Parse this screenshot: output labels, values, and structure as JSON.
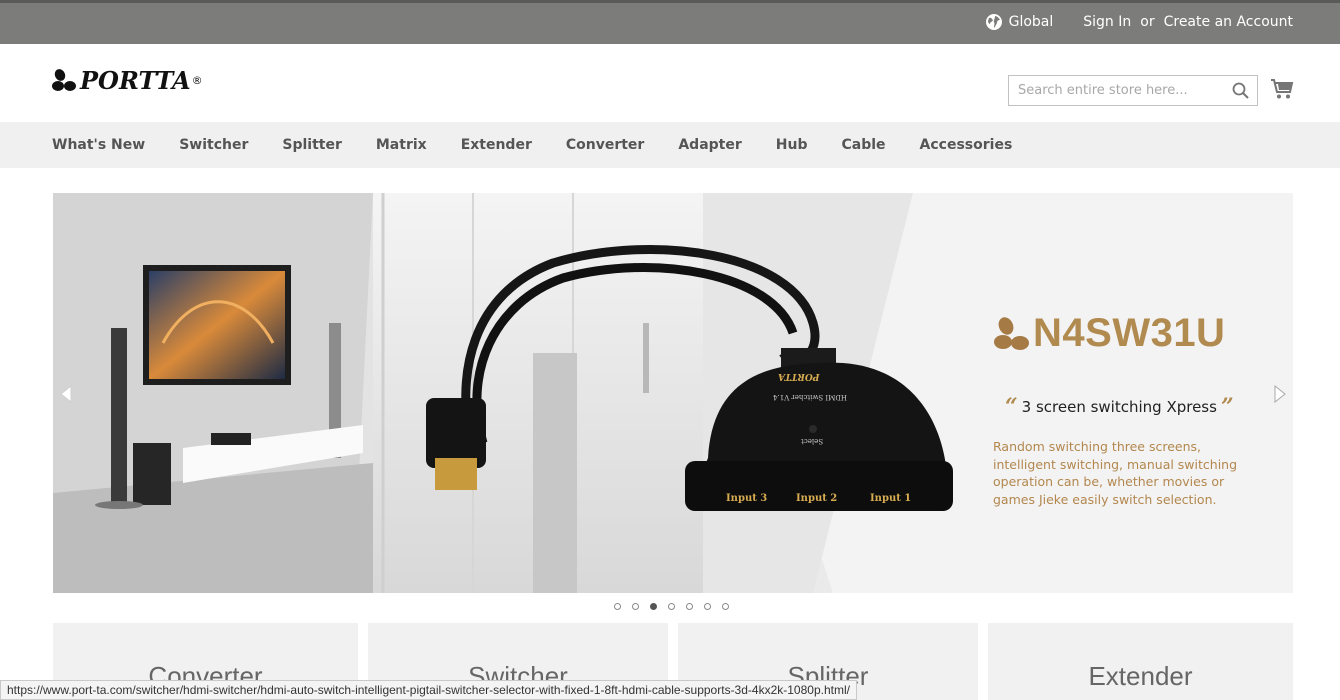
{
  "topbar": {
    "region_label": "Global",
    "signin_label": "Sign In",
    "or_label": "or",
    "create_account_label": "Create an Account"
  },
  "header": {
    "logo_text": "PORTTA",
    "logo_reg": "®",
    "search_placeholder": "Search entire store here...",
    "icons": {
      "search": "search-icon",
      "cart": "cart-icon",
      "globe": "globe-icon"
    }
  },
  "nav": {
    "items": [
      {
        "label": "What's New"
      },
      {
        "label": "Switcher"
      },
      {
        "label": "Splitter"
      },
      {
        "label": "Matrix"
      },
      {
        "label": "Extender"
      },
      {
        "label": "Converter"
      },
      {
        "label": "Adapter"
      },
      {
        "label": "Hub"
      },
      {
        "label": "Cable"
      },
      {
        "label": "Accessories"
      }
    ]
  },
  "banner": {
    "model": "N4SW31U",
    "tagline": "3 screen switching Xpress",
    "description": "Random switching three screens, intelligent switching, manual switching operation can be, whether movies or games Jieke easily switch selection.",
    "product_labels": [
      "Input 3",
      "Input 2",
      "Input 1"
    ],
    "device_brand": "PORTTA",
    "device_model_text": "HDMI Switcher V1.4",
    "device_select_label": "Select",
    "slide_count": 7,
    "active_slide": 3,
    "accent_color": "#b18a4f"
  },
  "categories": [
    {
      "label": "Converter"
    },
    {
      "label": "Switcher"
    },
    {
      "label": "Splitter"
    },
    {
      "label": "Extender"
    }
  ],
  "status_url": "https://www.port-ta.com/switcher/hdmi-switcher/hdmi-auto-switch-intelligent-pigtail-switcher-selector-with-fixed-1-8ft-hdmi-cable-supports-3d-4kx2k-1080p.html/"
}
